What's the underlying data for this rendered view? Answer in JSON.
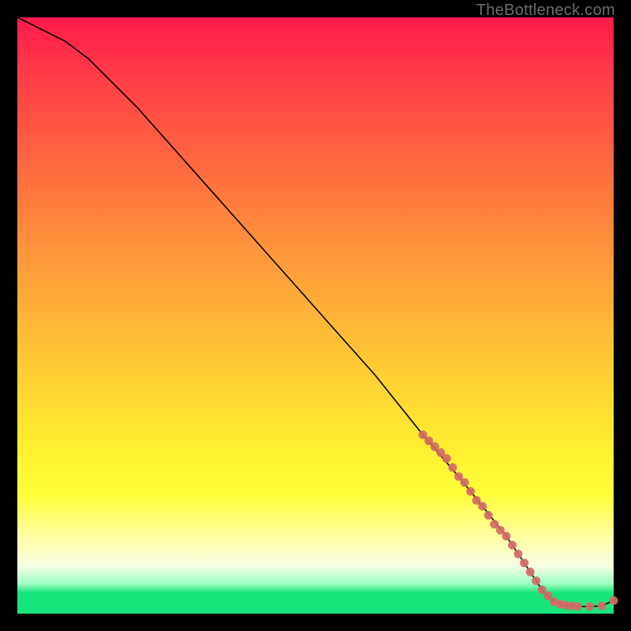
{
  "watermark": "TheBottleneck.com",
  "chart_data": {
    "type": "line",
    "title": "",
    "xlabel": "",
    "ylabel": "",
    "xlim": [
      0,
      100
    ],
    "ylim": [
      0,
      100
    ],
    "grid": false,
    "legend": false,
    "series": [
      {
        "name": "curve",
        "x": [
          0,
          4,
          8,
          12,
          16,
          20,
          28,
          36,
          44,
          52,
          60,
          68,
          74,
          78,
          82,
          86,
          88,
          90,
          92,
          94,
          96,
          98,
          100
        ],
        "y": [
          100,
          98,
          96,
          93,
          89,
          85,
          76,
          67,
          58,
          49,
          40,
          30,
          23,
          18,
          13,
          7,
          4,
          2,
          1.4,
          1.2,
          1.2,
          1.3,
          2.2
        ]
      }
    ],
    "highlight_points": {
      "note": "dense salmon markers along lower-right segment of curve",
      "x": [
        68,
        69,
        70,
        71,
        72,
        73,
        74,
        75,
        76,
        77,
        78,
        79,
        80,
        81,
        82,
        83,
        84,
        85,
        86,
        87,
        88,
        89,
        90,
        91,
        92,
        93,
        94,
        96,
        98,
        100
      ],
      "y": [
        30,
        29,
        28,
        27,
        26,
        24.5,
        23,
        22,
        20.5,
        19,
        18,
        16.5,
        15,
        14,
        13,
        11.5,
        10,
        8.5,
        7,
        5.5,
        4,
        3,
        2,
        1.6,
        1.4,
        1.3,
        1.2,
        1.2,
        1.3,
        2.2
      ]
    },
    "background_gradient": {
      "orientation": "vertical",
      "stops": [
        {
          "pos": 0.0,
          "color": "#ff1a4b"
        },
        {
          "pos": 0.5,
          "color": "#ffb437"
        },
        {
          "pos": 0.8,
          "color": "#ffff3a"
        },
        {
          "pos": 0.92,
          "color": "#f6ffe3"
        },
        {
          "pos": 0.97,
          "color": "#18e57e"
        },
        {
          "pos": 1.0,
          "color": "#18e57e"
        }
      ]
    }
  }
}
